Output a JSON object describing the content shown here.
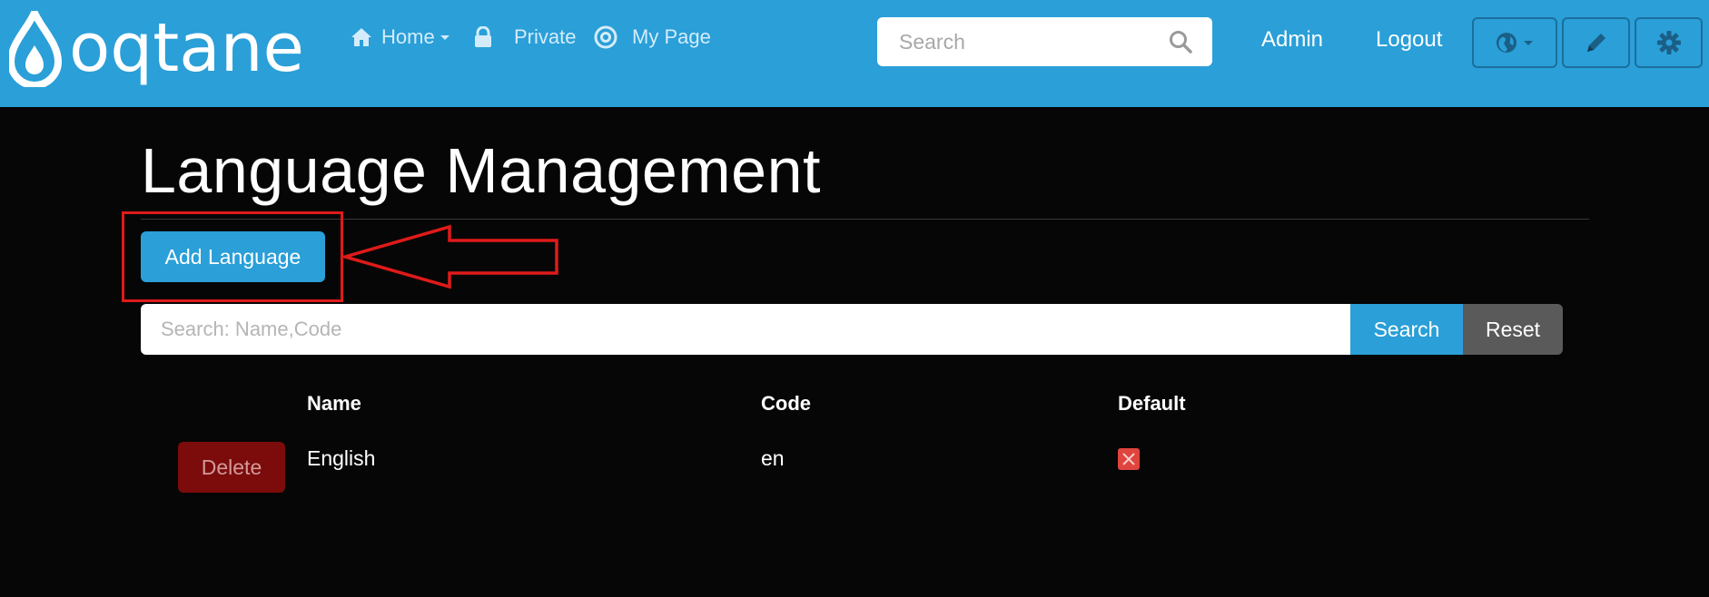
{
  "brand": {
    "logo_text": "oqtane"
  },
  "nav": {
    "items": [
      {
        "label": "Home",
        "icon": "home-icon",
        "dropdown": true
      },
      {
        "label": "Private",
        "icon": "lock-icon"
      },
      {
        "label": "My Page",
        "icon": "target-icon"
      }
    ]
  },
  "header": {
    "search_placeholder": "Search",
    "admin_label": "Admin",
    "logout_label": "Logout",
    "tools": [
      "globe-icon",
      "pencil-icon",
      "gear-icon"
    ]
  },
  "page": {
    "title": "Language Management",
    "add_button_label": "Add Language"
  },
  "filter": {
    "placeholder": "Search: Name,Code",
    "search_label": "Search",
    "reset_label": "Reset"
  },
  "table": {
    "columns": [
      "Name",
      "Code",
      "Default"
    ],
    "rows": [
      {
        "delete_label": "Delete",
        "name": "English",
        "code": "en",
        "default": false
      }
    ]
  },
  "colors": {
    "navbar": "#2a9fd8",
    "background": "#060606",
    "annotation": "#e01a1a",
    "delete": "#7c0b0b",
    "reset": "#5a5a5a"
  }
}
